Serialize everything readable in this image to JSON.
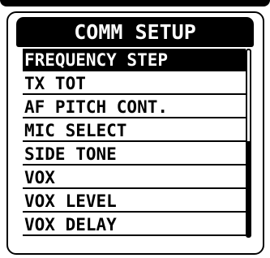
{
  "title": "COMM SETUP",
  "menu": {
    "items": [
      {
        "label": "FREQUENCY STEP",
        "selected": true
      },
      {
        "label": "TX TOT",
        "selected": false
      },
      {
        "label": "AF PITCH CONT.",
        "selected": false
      },
      {
        "label": "MIC SELECT",
        "selected": false
      },
      {
        "label": "SIDE TONE",
        "selected": false
      },
      {
        "label": "VOX",
        "selected": false
      },
      {
        "label": "VOX LEVEL",
        "selected": false
      },
      {
        "label": "VOX DELAY",
        "selected": false
      }
    ]
  },
  "scrollbar": {
    "visible_fraction": 0.5,
    "scroll_position": "bottom"
  },
  "colors": {
    "foreground": "#000000",
    "background": "#ffffff",
    "highlight_text": "#ffffff"
  }
}
